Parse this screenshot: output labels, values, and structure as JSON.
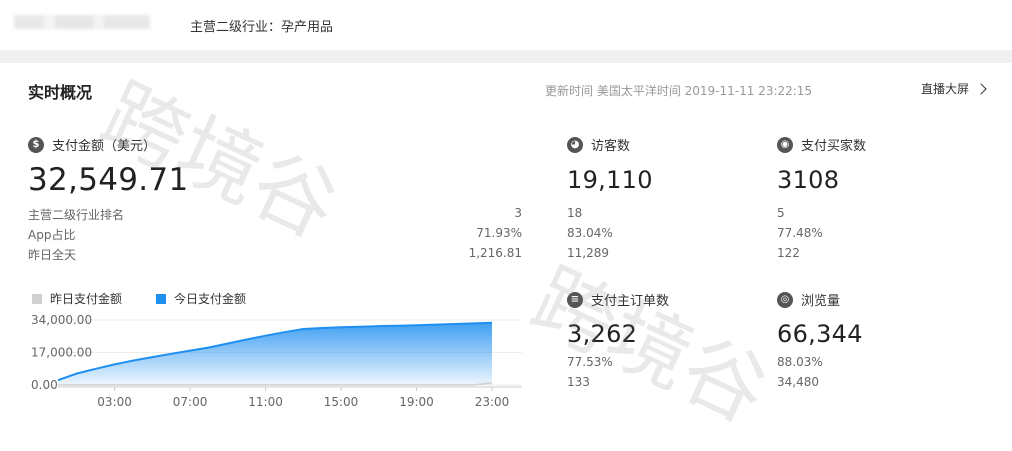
{
  "header": {
    "industry": "主营二级行业：孕产用品"
  },
  "realtime": {
    "title": "实时概况",
    "update_time": "更新时间 美国太平洋时间 2019-11-11 23:22:15",
    "live_screen": "直播大屏"
  },
  "payment": {
    "label": "支付金额（美元）",
    "value": "32,549.71",
    "rows": [
      {
        "label": "主营二级行业排名",
        "value": "3"
      },
      {
        "label": "App占比",
        "value": "71.93%"
      },
      {
        "label": "昨日全天",
        "value": "1,216.81"
      }
    ]
  },
  "visitors": {
    "label": "访客数",
    "value": "19,110",
    "subs": [
      "18",
      "83.04%",
      "11,289"
    ]
  },
  "buyers": {
    "label": "支付买家数",
    "value": "3108",
    "subs": [
      "5",
      "77.48%",
      "122"
    ]
  },
  "orders": {
    "label": "支付主订单数",
    "value": "3,262",
    "subs": [
      "77.53%",
      "133"
    ]
  },
  "pageviews": {
    "label": "浏览量",
    "value": "66,344",
    "subs": [
      "88.03%",
      "34,480"
    ]
  },
  "icons": {
    "payment": "dollar-icon",
    "visitors": "visitor-icon",
    "buyers": "buyers-icon",
    "orders": "order-icon",
    "pageviews": "eye-icon"
  },
  "legend": {
    "yesterday": "昨日支付金额",
    "today": "今日支付金额",
    "yesterday_color": "#d0d0d0",
    "today_color": "#1f8ff0"
  },
  "chart_data": {
    "type": "area",
    "y_ticks": [
      "34,000.00",
      "17,000.00",
      "0.00"
    ],
    "ylim": [
      0,
      34000
    ],
    "x_ticks": [
      "03:00",
      "07:00",
      "11:00",
      "15:00",
      "19:00",
      "23:00"
    ],
    "x": [
      0,
      1,
      2,
      3,
      4,
      5,
      6,
      7,
      8,
      9,
      10,
      11,
      12,
      13,
      14,
      15,
      16,
      17,
      18,
      19,
      20,
      21,
      22,
      23
    ],
    "series": [
      {
        "name": "今日支付金额",
        "values": [
          2500,
          6000,
          8500,
          10800,
          12800,
          14600,
          16300,
          18000,
          19600,
          21700,
          23800,
          25800,
          27600,
          29300,
          29800,
          30200,
          30500,
          30800,
          31000,
          31300,
          31600,
          31900,
          32200,
          32550
        ]
      },
      {
        "name": "昨日支付金额",
        "values": [
          0,
          0,
          0,
          0,
          0,
          0,
          0,
          0,
          0,
          0,
          0,
          0,
          0,
          0,
          0,
          0,
          0,
          0,
          0,
          0,
          0,
          0,
          0,
          1217
        ]
      }
    ]
  },
  "watermark": {
    "text1": "跨境谷",
    "text2": "跨境谷"
  }
}
